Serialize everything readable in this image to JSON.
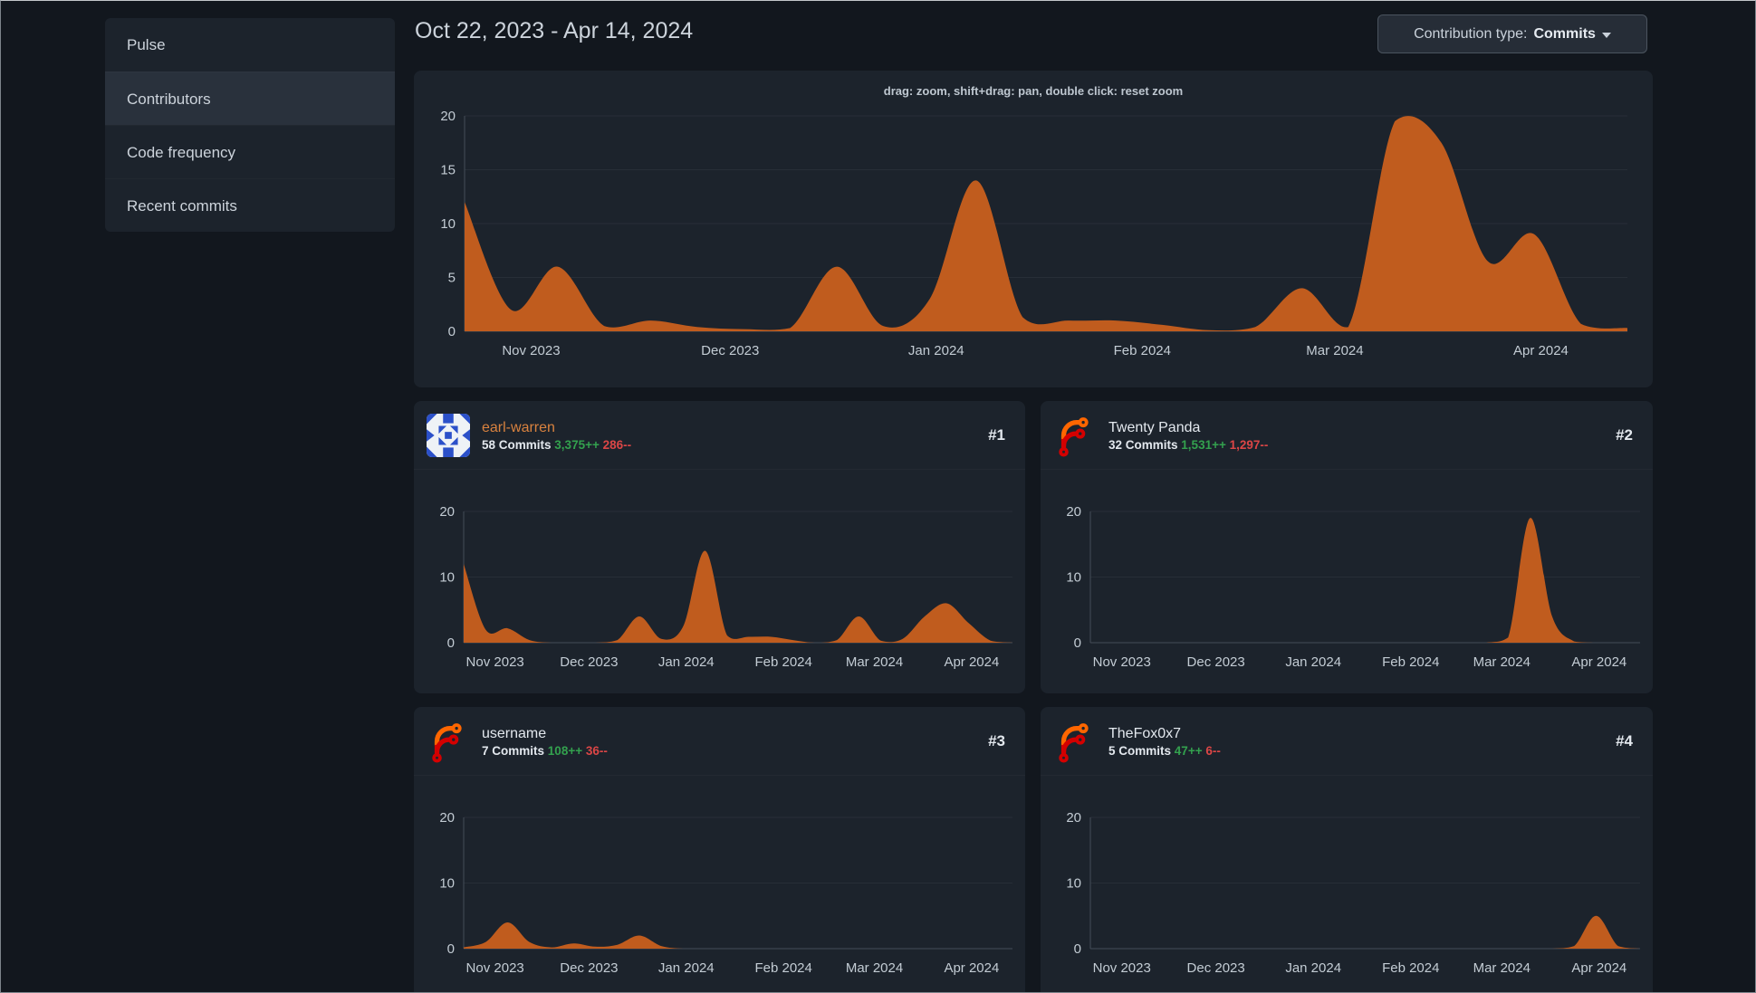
{
  "sidebar": {
    "items": [
      {
        "label": "Pulse",
        "active": false
      },
      {
        "label": "Contributors",
        "active": true
      },
      {
        "label": "Code frequency",
        "active": false
      },
      {
        "label": "Recent commits",
        "active": false
      }
    ]
  },
  "header": {
    "date_range": "Oct 22, 2023 - Apr 14, 2024",
    "contribution_type_label": "Contribution type:",
    "contribution_type_value": "Commits"
  },
  "main_chart_hint": "drag: zoom, shift+drag: pan, double click: reset zoom",
  "contributors": [
    {
      "name": "earl-warren",
      "commits_label": "58 Commits",
      "additions": "3,375++",
      "deletions": "286--",
      "rank": "#1",
      "avatar": "identicon-blue",
      "linked": true
    },
    {
      "name": "Twenty Panda",
      "commits_label": "32 Commits",
      "additions": "1,531++",
      "deletions": "1,297--",
      "rank": "#2",
      "avatar": "forgejo-logo",
      "linked": false
    },
    {
      "name": "username",
      "commits_label": "7 Commits",
      "additions": "108++",
      "deletions": "36--",
      "rank": "#3",
      "avatar": "forgejo-logo",
      "linked": false
    },
    {
      "name": "TheFox0x7",
      "commits_label": "5 Commits",
      "additions": "47++",
      "deletions": "6--",
      "rank": "#4",
      "avatar": "forgejo-logo",
      "linked": false
    }
  ],
  "chart_data": [
    {
      "id": "overall-commits",
      "type": "area",
      "x_unit": "weeks since Oct 22, 2023",
      "weeks_total": 25,
      "ylim": [
        0,
        20
      ],
      "y_ticks": [
        0,
        5,
        10,
        15,
        20
      ],
      "grid": true,
      "legend": false,
      "x_ticks": [
        {
          "label": "Nov 2023",
          "week": 1.43
        },
        {
          "label": "Dec 2023",
          "week": 5.71
        },
        {
          "label": "Jan 2024",
          "week": 10.14
        },
        {
          "label": "Feb 2024",
          "week": 14.57
        },
        {
          "label": "Mar 2024",
          "week": 18.71
        },
        {
          "label": "Apr 2024",
          "week": 23.14
        }
      ],
      "values": [
        12,
        2,
        6,
        0.5,
        1,
        0.4,
        0.2,
        0.3,
        6,
        0.5,
        3,
        14,
        1.3,
        1,
        1,
        0.6,
        0.1,
        0.4,
        4,
        0.4,
        19.5,
        17.5,
        6.5,
        9,
        0.7,
        0.3
      ],
      "fill": "#c05c1e"
    },
    {
      "id": "earl-warren",
      "type": "area",
      "x_unit": "weeks since Oct 22, 2023",
      "weeks_total": 25,
      "ylim": [
        0,
        20
      ],
      "y_ticks": [
        0,
        10,
        20
      ],
      "grid": true,
      "legend": false,
      "x_ticks": [
        {
          "label": "Nov 2023",
          "week": 1.43
        },
        {
          "label": "Dec 2023",
          "week": 5.71
        },
        {
          "label": "Jan 2024",
          "week": 10.14
        },
        {
          "label": "Feb 2024",
          "week": 14.57
        },
        {
          "label": "Mar 2024",
          "week": 18.71
        },
        {
          "label": "Apr 2024",
          "week": 23.14
        }
      ],
      "values": [
        12,
        2,
        2.2,
        0.4,
        0,
        0,
        0,
        0.4,
        4,
        0.6,
        2.5,
        14,
        1.1,
        0.9,
        0.9,
        0.4,
        0,
        0.4,
        4,
        0.3,
        0.6,
        4,
        6,
        3,
        0.3,
        0
      ],
      "fill": "#c05c1e"
    },
    {
      "id": "twenty-panda",
      "type": "area",
      "x_unit": "weeks since Oct 22, 2023",
      "weeks_total": 25,
      "ylim": [
        0,
        20
      ],
      "y_ticks": [
        0,
        10,
        20
      ],
      "grid": true,
      "legend": false,
      "x_ticks": [
        {
          "label": "Nov 2023",
          "week": 1.43
        },
        {
          "label": "Dec 2023",
          "week": 5.71
        },
        {
          "label": "Jan 2024",
          "week": 10.14
        },
        {
          "label": "Feb 2024",
          "week": 14.57
        },
        {
          "label": "Mar 2024",
          "week": 18.71
        },
        {
          "label": "Apr 2024",
          "week": 23.14
        }
      ],
      "values": [
        0,
        0,
        0,
        0,
        0,
        0,
        0,
        0,
        0,
        0,
        0,
        0,
        0,
        0,
        0,
        0,
        0,
        0,
        0,
        0.8,
        19,
        4,
        0.2,
        0,
        0,
        0
      ],
      "fill": "#c05c1e"
    },
    {
      "id": "username",
      "type": "area",
      "x_unit": "weeks since Oct 22, 2023",
      "weeks_total": 25,
      "ylim": [
        0,
        20
      ],
      "y_ticks": [
        0,
        10,
        20
      ],
      "grid": true,
      "legend": false,
      "x_ticks": [
        {
          "label": "Nov 2023",
          "week": 1.43
        },
        {
          "label": "Dec 2023",
          "week": 5.71
        },
        {
          "label": "Jan 2024",
          "week": 10.14
        },
        {
          "label": "Feb 2024",
          "week": 14.57
        },
        {
          "label": "Mar 2024",
          "week": 18.71
        },
        {
          "label": "Apr 2024",
          "week": 23.14
        }
      ],
      "values": [
        0.2,
        1,
        4,
        1,
        0.2,
        0.8,
        0.3,
        0.6,
        2,
        0.4,
        0,
        0,
        0,
        0,
        0,
        0,
        0,
        0,
        0,
        0,
        0,
        0,
        0,
        0,
        0,
        0
      ],
      "fill": "#c05c1e"
    },
    {
      "id": "thefox0x7",
      "type": "area",
      "x_unit": "weeks since Oct 22, 2023",
      "weeks_total": 25,
      "ylim": [
        0,
        20
      ],
      "y_ticks": [
        0,
        10,
        20
      ],
      "grid": true,
      "legend": false,
      "x_ticks": [
        {
          "label": "Nov 2023",
          "week": 1.43
        },
        {
          "label": "Dec 2023",
          "week": 5.71
        },
        {
          "label": "Jan 2024",
          "week": 10.14
        },
        {
          "label": "Feb 2024",
          "week": 14.57
        },
        {
          "label": "Mar 2024",
          "week": 18.71
        },
        {
          "label": "Apr 2024",
          "week": 23.14
        }
      ],
      "values": [
        0,
        0,
        0,
        0,
        0,
        0,
        0,
        0,
        0,
        0,
        0,
        0,
        0,
        0,
        0,
        0,
        0,
        0,
        0,
        0,
        0,
        0,
        0.4,
        5,
        0.4,
        0
      ],
      "fill": "#c05c1e"
    }
  ],
  "colors": {
    "page_bg": "#12171e",
    "panel_bg": "#1c232c",
    "sidebar_selected_bg": "#29313c",
    "text_primary": "#e3e8ee",
    "text_secondary": "#ccd3db",
    "tick_text": "#c3ccd4",
    "link_orange": "#d9823f",
    "green_additions": "#33a14e",
    "red_deletions": "#db4646",
    "area_fill": "#c05c1e",
    "grid_line": "#272e37",
    "axis_line": "#454d57",
    "button_border": "#4b545f",
    "forgejo_orange": "#ff6600",
    "forgejo_red": "#d40000",
    "identicon_blue": "#2b50c9"
  }
}
